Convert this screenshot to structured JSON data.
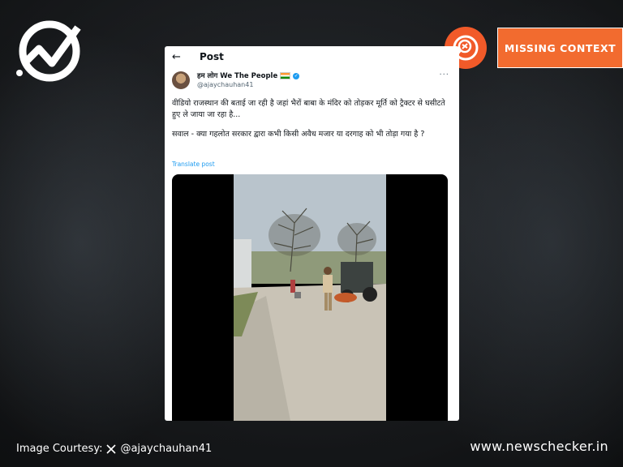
{
  "colors": {
    "accent": "#f26b2f",
    "link": "#1d9bf0",
    "verified": "#1d9bf0"
  },
  "badge": {
    "label": "MISSING CONTEXT",
    "icon": "magnifier-icon"
  },
  "post": {
    "header": {
      "title": "Post",
      "back_icon": "back-arrow-icon"
    },
    "author": {
      "name": "हम लोग We The People",
      "handle": "@ajaychauhan41"
    },
    "text_1": "वीडियो राजस्थान की बताई जा रही है जहां भैरों बाबा के मंदिर को तोड़कर मूर्ति को ट्रैक्टर से घसीटते हुए ले जाया जा रहा है...",
    "text_2": "सवाल - क्या गहलोत सरकार द्वारा कभी किसी अवैध मजार या दरगाह को भी तोड़ा गया है ?",
    "translate": "Translate post"
  },
  "footer": {
    "courtesy_label": "Image Courtesy:",
    "courtesy_handle": "@ajaychauhan41",
    "site": "www.newschecker.in"
  }
}
